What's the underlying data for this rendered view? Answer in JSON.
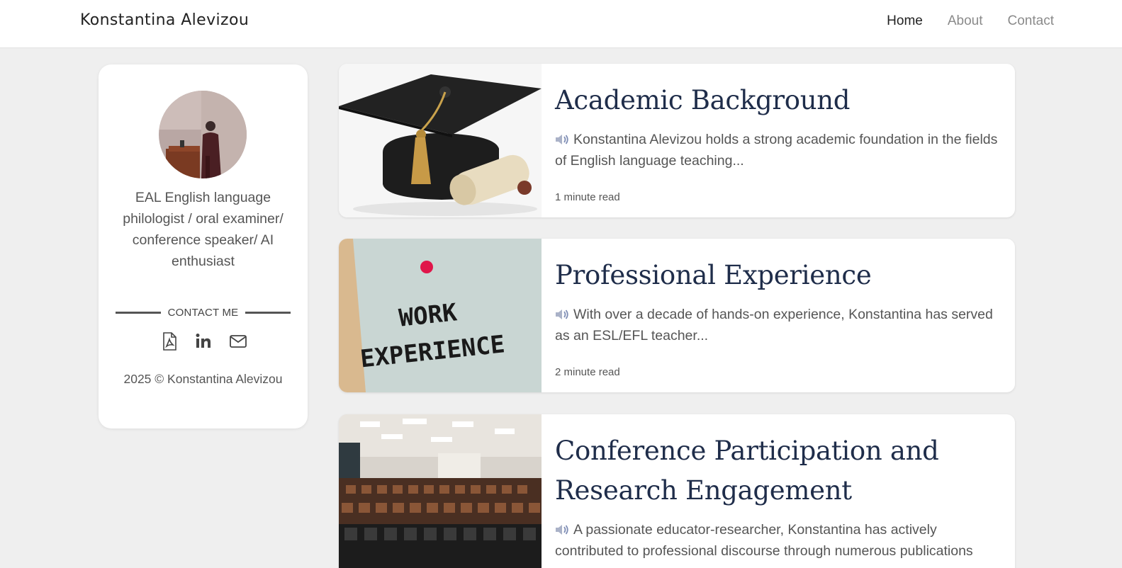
{
  "header": {
    "brand": "Konstantina Alevizou",
    "nav": [
      {
        "label": "Home",
        "active": true
      },
      {
        "label": "About",
        "active": false
      },
      {
        "label": "Contact",
        "active": false
      }
    ]
  },
  "profile": {
    "bio": "EAL English language philologist / oral examiner/ conference speaker/ AI enthusiast",
    "contact_label": "CONTACT ME",
    "icons": [
      "pdf-icon",
      "linkedin-icon",
      "email-icon"
    ],
    "footer": "2025 © Konstantina Alevizou"
  },
  "posts": [
    {
      "title": "Academic Background",
      "excerpt": "Konstantina Alevizou holds a strong academic foundation in the fields of English language teaching...",
      "read_time": "1 minute read",
      "image": "graduation-cap-diploma"
    },
    {
      "title": "Professional Experience",
      "excerpt": "With over a decade of hands-on experience, Konstantina has served as an ESL/EFL teacher...",
      "read_time": "2 minute read",
      "image": "work-experience-note",
      "image_text": [
        "WORK",
        "EXPERIENCE"
      ]
    },
    {
      "title": "Conference Participation and Research Engagement",
      "excerpt": "A passionate educator-researcher, Konstantina has actively contributed to professional discourse through numerous publications",
      "read_time": "",
      "image": "lecture-hall"
    }
  ],
  "colors": {
    "background": "#efefef",
    "title": "#1f2d4a",
    "text": "#555555"
  }
}
